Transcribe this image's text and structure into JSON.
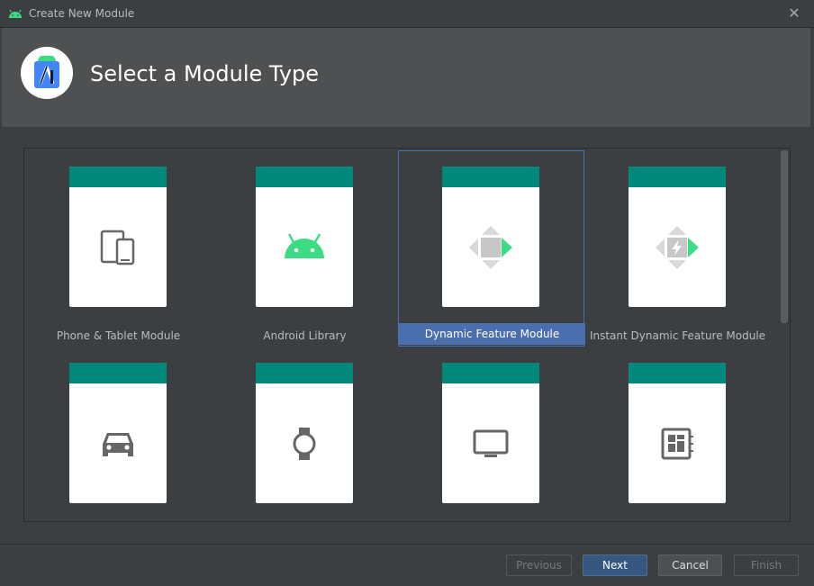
{
  "window": {
    "title": "Create New Module"
  },
  "header": {
    "title": "Select a Module Type"
  },
  "colors": {
    "accent": "#00897b",
    "selection": "#4b6eaf",
    "android_green": "#3ddc84"
  },
  "modules": [
    {
      "label": "Phone & Tablet Module",
      "icon": "phone-tablet-icon",
      "selected": false
    },
    {
      "label": "Android Library",
      "icon": "android-icon",
      "selected": false
    },
    {
      "label": "Dynamic Feature Module",
      "icon": "dynamic-feature-icon",
      "selected": true
    },
    {
      "label": "Instant Dynamic Feature Module",
      "icon": "instant-dynamic-feature-icon",
      "selected": false
    },
    {
      "label": "",
      "icon": "car-icon",
      "selected": false
    },
    {
      "label": "",
      "icon": "watch-icon",
      "selected": false
    },
    {
      "label": "",
      "icon": "tv-icon",
      "selected": false
    },
    {
      "label": "",
      "icon": "things-board-icon",
      "selected": false
    }
  ],
  "buttons": {
    "previous": "Previous",
    "next": "Next",
    "cancel": "Cancel",
    "finish": "Finish"
  }
}
